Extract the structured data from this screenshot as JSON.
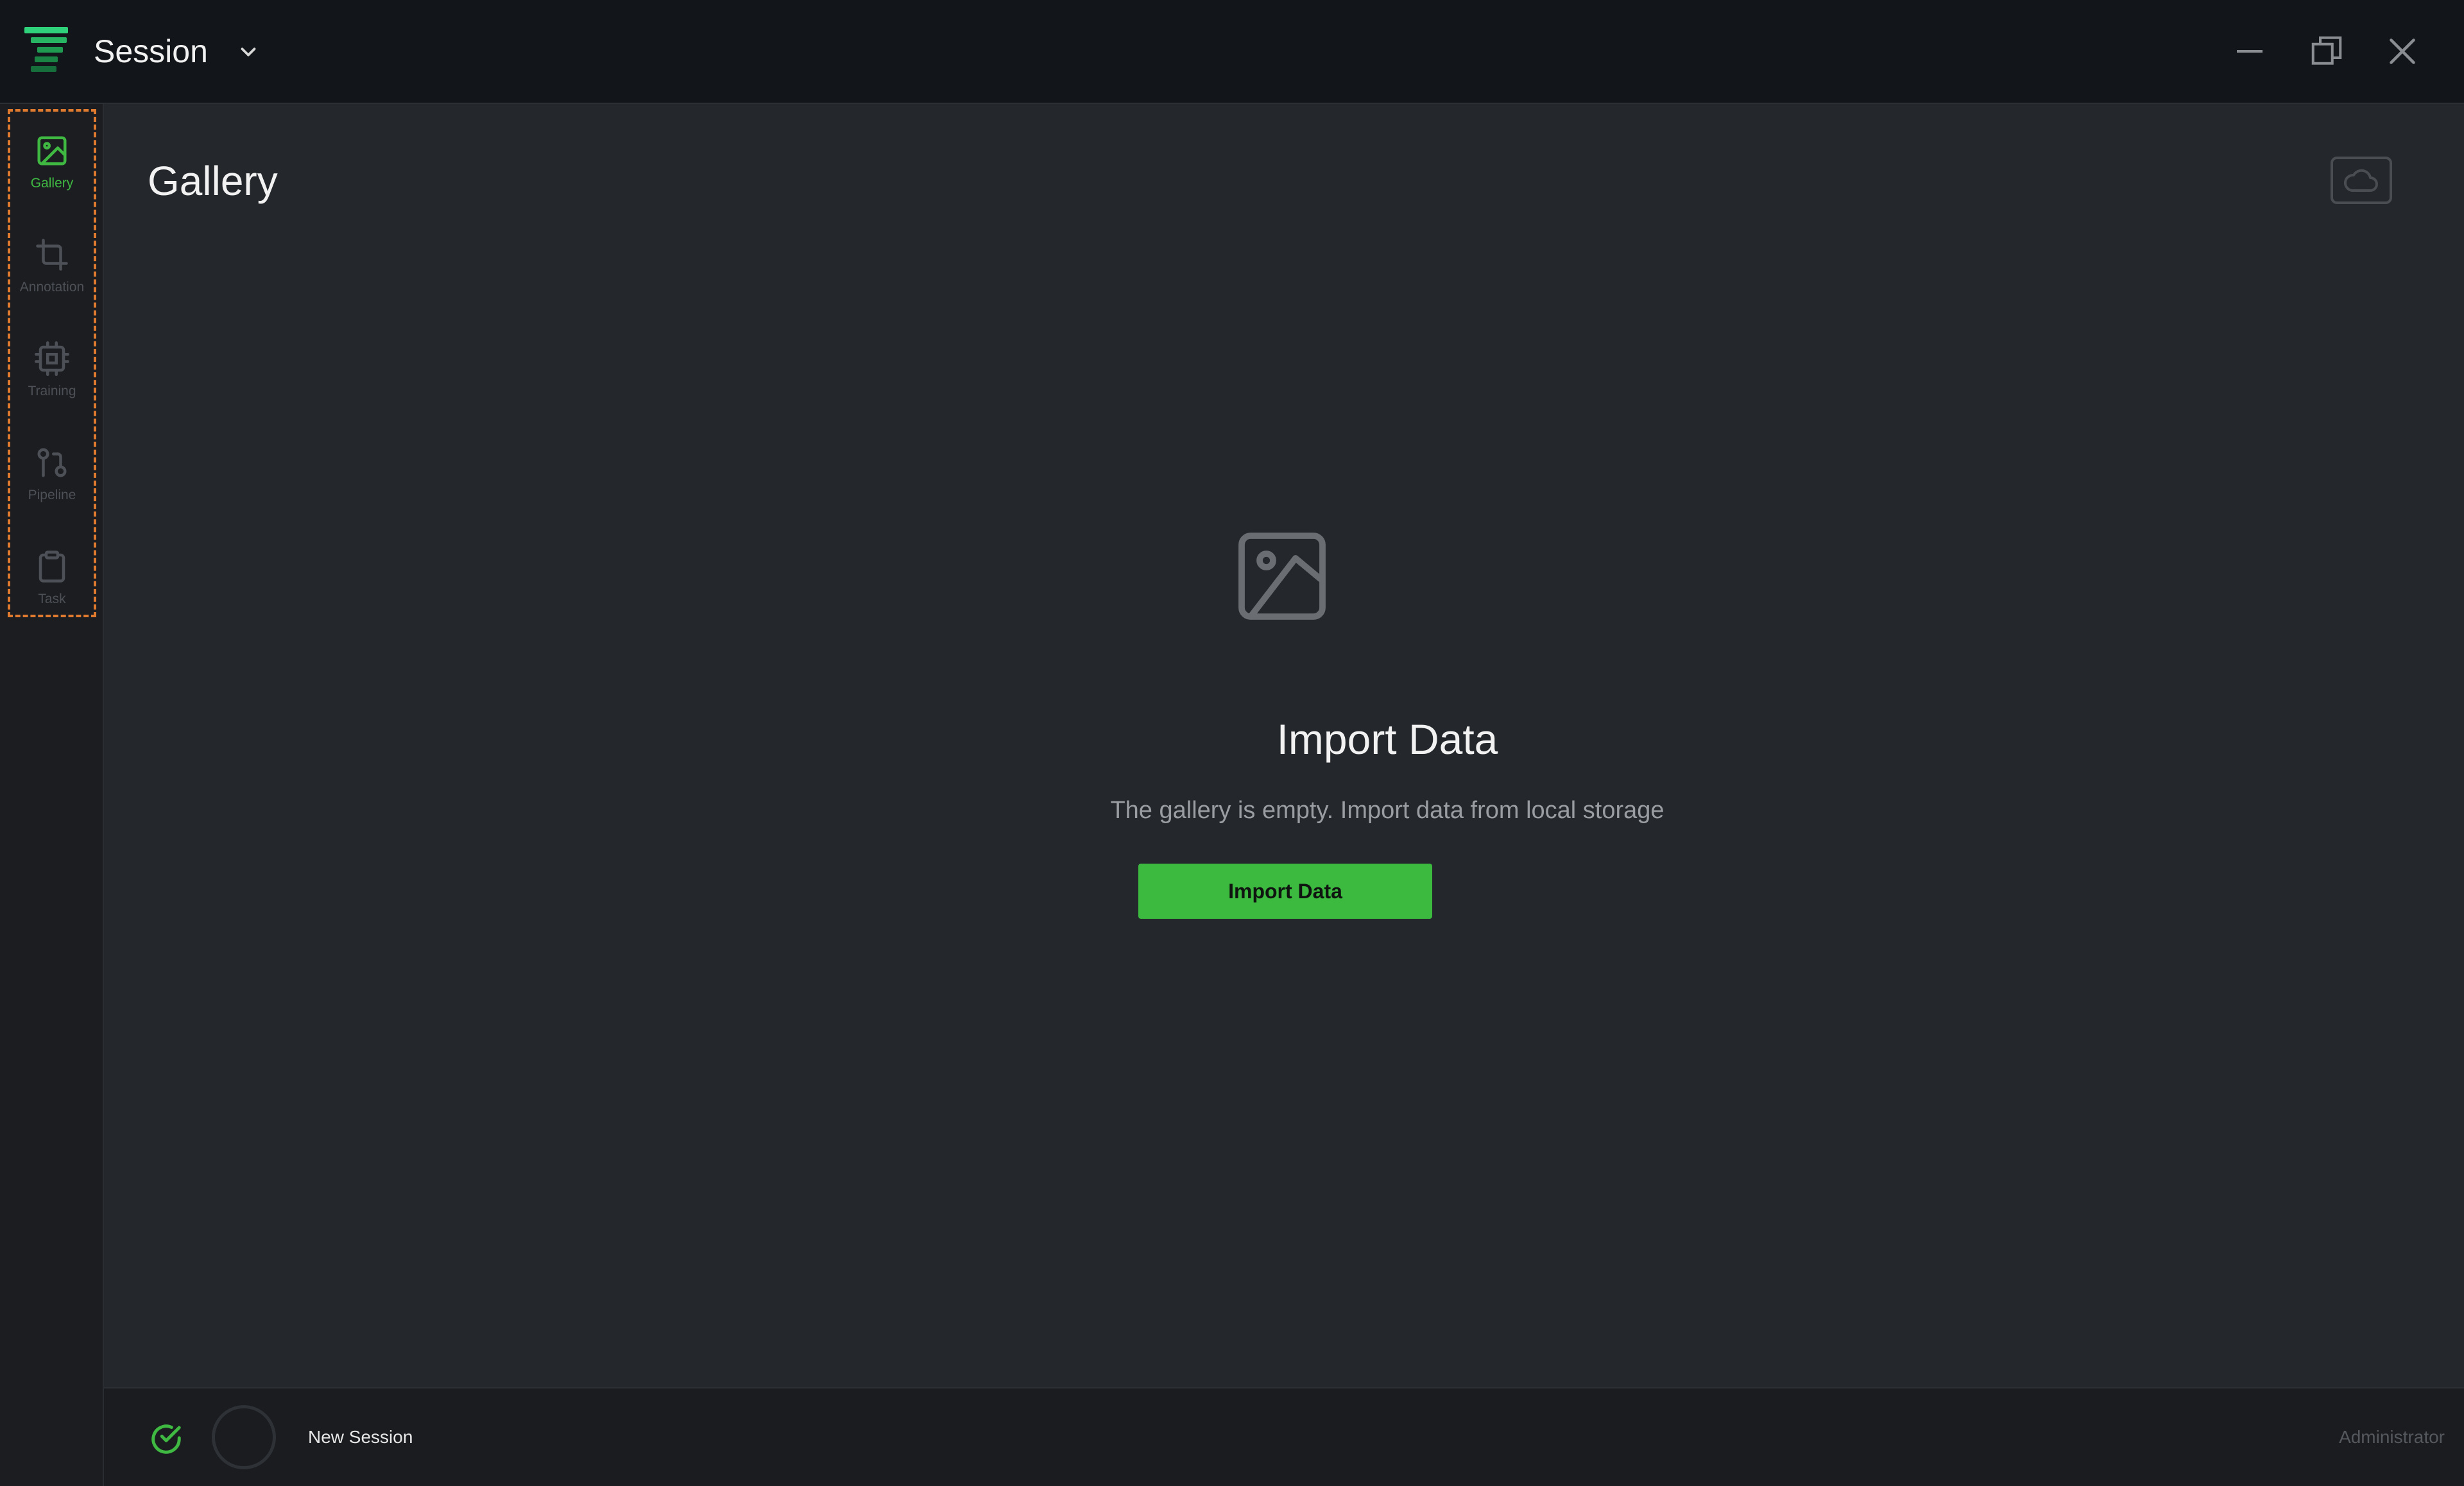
{
  "titlebar": {
    "title": "Session"
  },
  "sidebar": {
    "items": [
      {
        "label": "Gallery",
        "icon": "image-icon",
        "active": true
      },
      {
        "label": "Annotation",
        "icon": "crop-icon",
        "active": false
      },
      {
        "label": "Training",
        "icon": "cpu-icon",
        "active": false
      },
      {
        "label": "Pipeline",
        "icon": "git-pull-request-icon",
        "active": false
      },
      {
        "label": "Task",
        "icon": "clipboard-icon",
        "active": false
      }
    ]
  },
  "main": {
    "title": "Gallery",
    "empty_state": {
      "heading": "Import Data",
      "description": "The gallery is empty. Import data from local storage",
      "button_label": "Import Data"
    }
  },
  "statusbar": {
    "session_name": "New Session",
    "user": "Administrator"
  },
  "colors": {
    "accent": "#3cb93f",
    "background": "#24272b",
    "titlebar": "#121519",
    "highlight_border": "#e07a2f"
  }
}
